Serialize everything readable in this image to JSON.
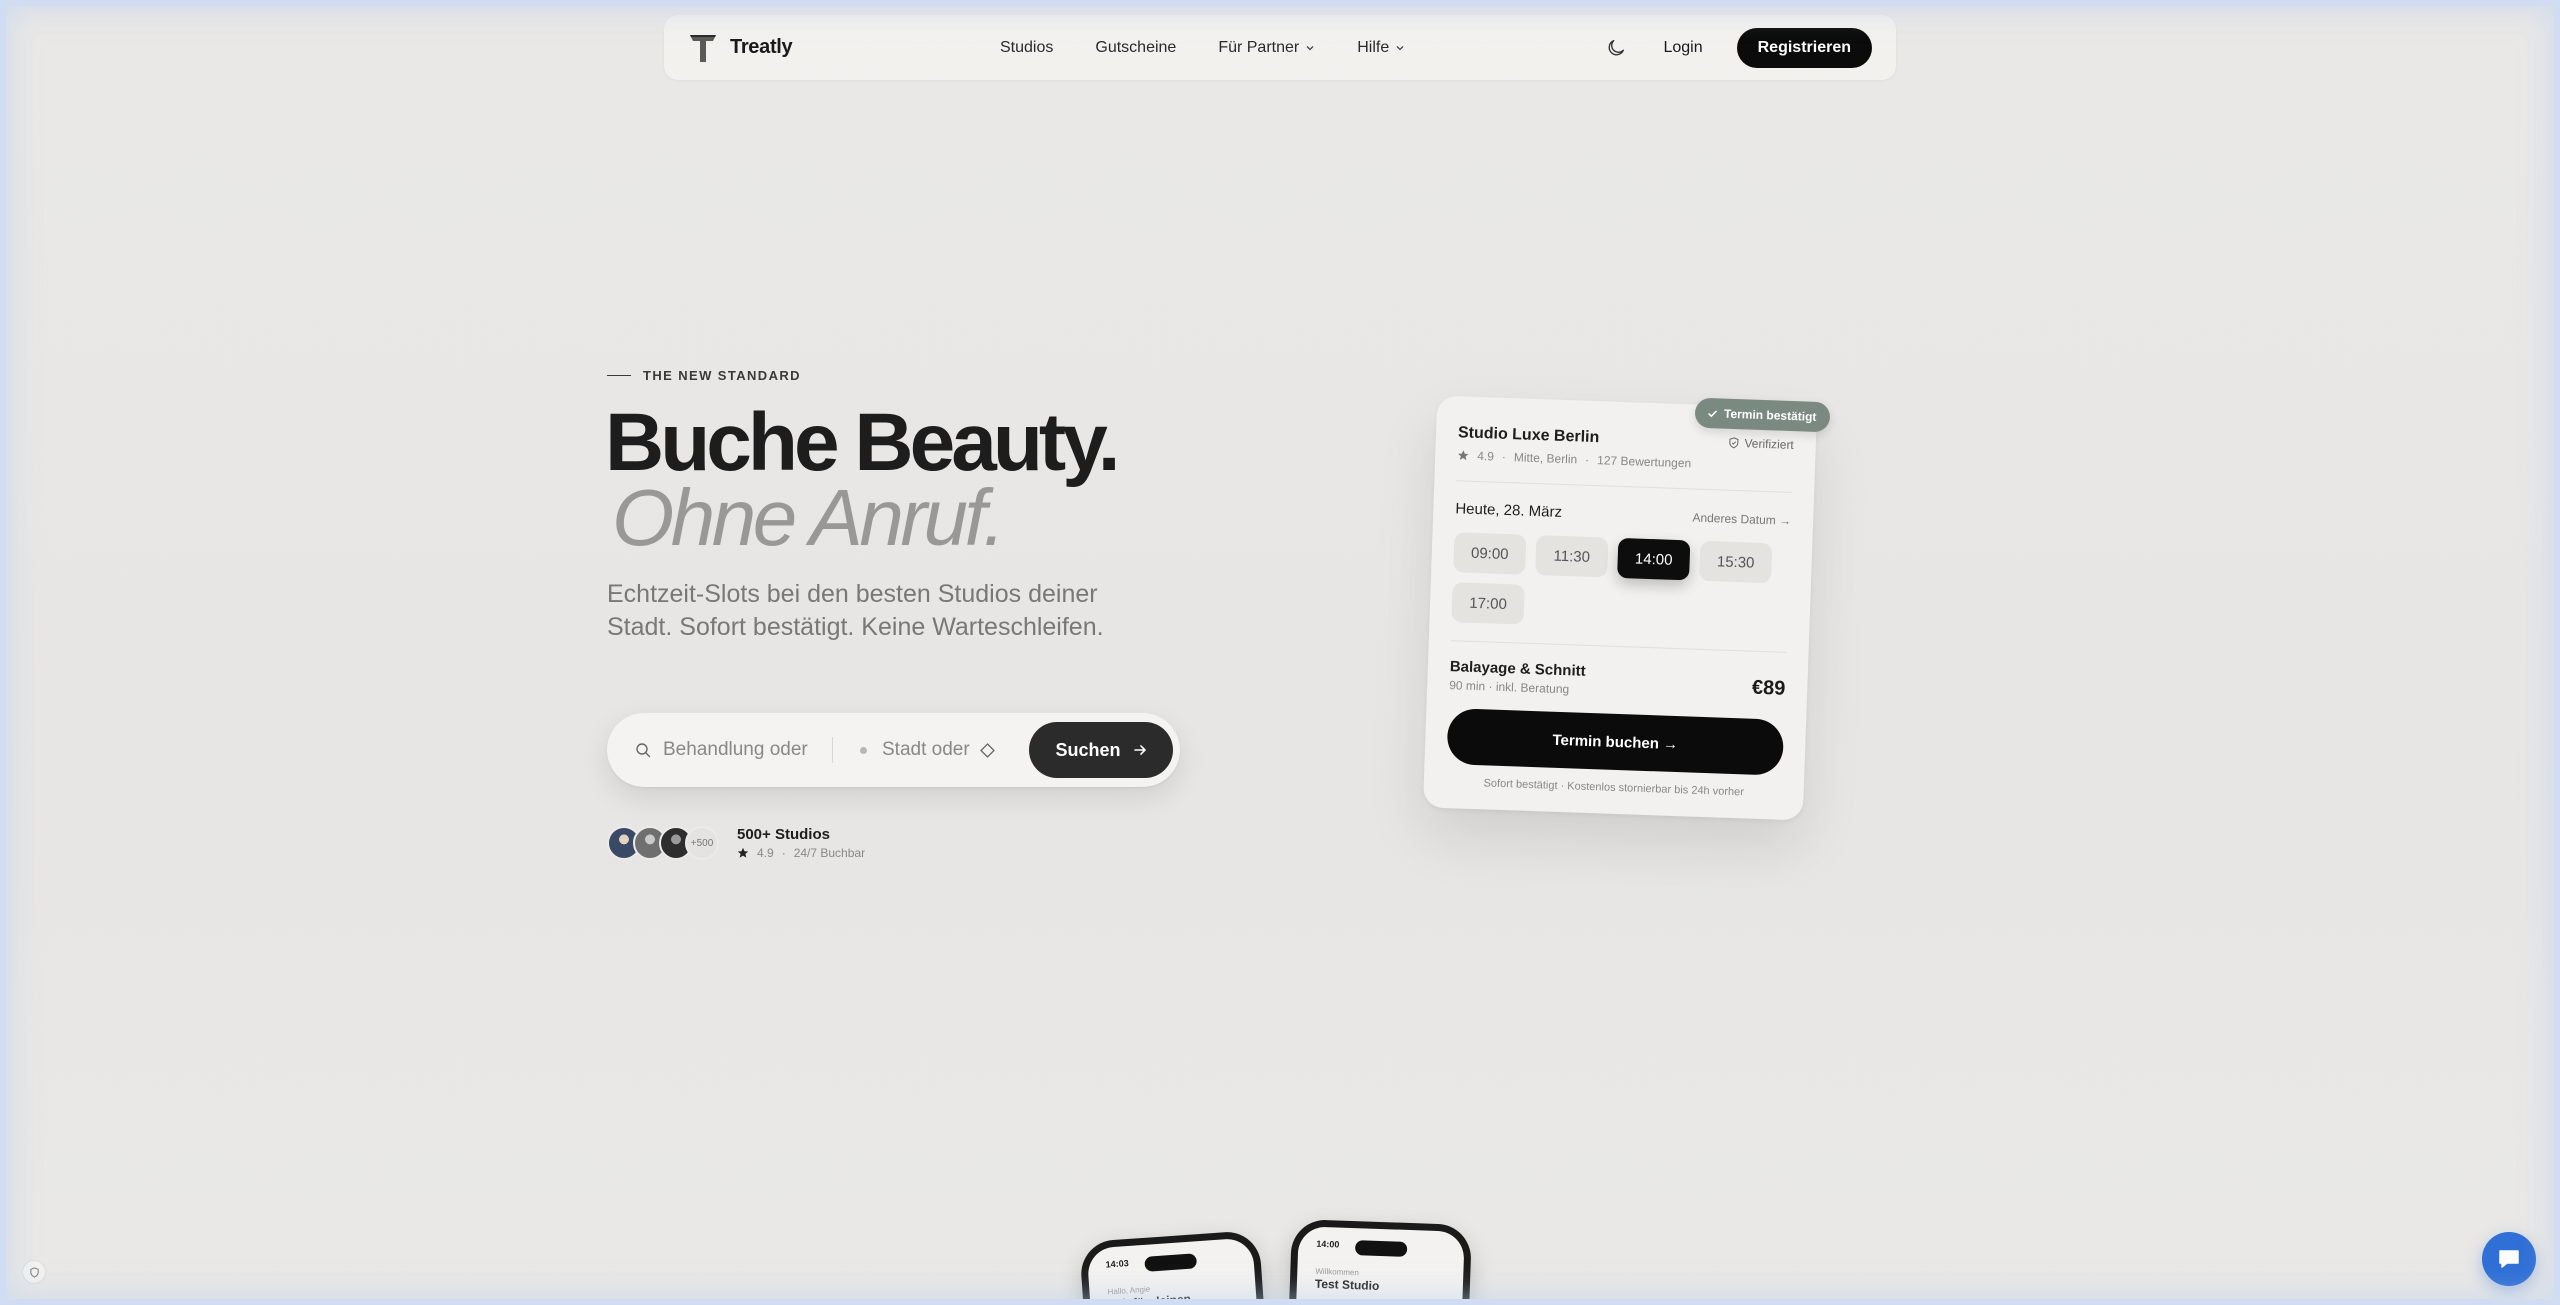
{
  "nav": {
    "brand": "Treatly",
    "links": [
      {
        "label": "Studios",
        "has_dropdown": false
      },
      {
        "label": "Gutscheine",
        "has_dropdown": false
      },
      {
        "label": "Für Partner",
        "has_dropdown": true
      },
      {
        "label": "Hilfe",
        "has_dropdown": true
      }
    ],
    "theme_toggle_icon": "moon-icon",
    "login": "Login",
    "register": "Registrieren"
  },
  "hero": {
    "eyebrow": "THE NEW STANDARD",
    "headline": "Buche Beauty.",
    "headline_italic": "Ohne Anruf.",
    "subtitle": "Echtzeit-Slots bei den besten Studios deiner Stadt. Sofort bestätigt. Keine Warteschleifen.",
    "search": {
      "treatment_placeholder": "Behandlung oder Studio",
      "city_placeholder": "Stadt oder PLZ",
      "button": "Suchen"
    },
    "proof": {
      "avatar_count_label": "+500",
      "title": "500+ Studios",
      "rating": "4.9",
      "availability": "24/7 Buchbar"
    }
  },
  "booking_card": {
    "badge": "Termin bestätigt",
    "studio": "Studio Luxe Berlin",
    "verified": "Verifiziert",
    "rating": "4.9",
    "location": "Mitte, Berlin",
    "reviews": "127 Bewertungen",
    "date": "Heute, 28. März",
    "other_date": "Anderes Datum →",
    "slots": [
      {
        "time": "09:00",
        "selected": false
      },
      {
        "time": "11:30",
        "selected": false
      },
      {
        "time": "14:00",
        "selected": true
      },
      {
        "time": "15:30",
        "selected": false
      },
      {
        "time": "17:00",
        "selected": false
      }
    ],
    "service": "Balayage & Schnitt",
    "service_meta": "90 min · inkl. Beratung",
    "price": "€89",
    "book_button": "Termin buchen →",
    "footnote": "Sofort bestätigt · Kostenlos stornierbar bis 24h vorher"
  },
  "phones": [
    {
      "time": "14:03",
      "small": "Hallo, Angie",
      "big": "Zeit für deinen"
    },
    {
      "time": "14:00",
      "small": "Willkommen",
      "big": "Test Studio"
    }
  ],
  "colors": {
    "background": "#e8e7e5",
    "primary": "#0b0b0b",
    "badge": "#7b8a80",
    "chat": "#2f6fd6"
  }
}
